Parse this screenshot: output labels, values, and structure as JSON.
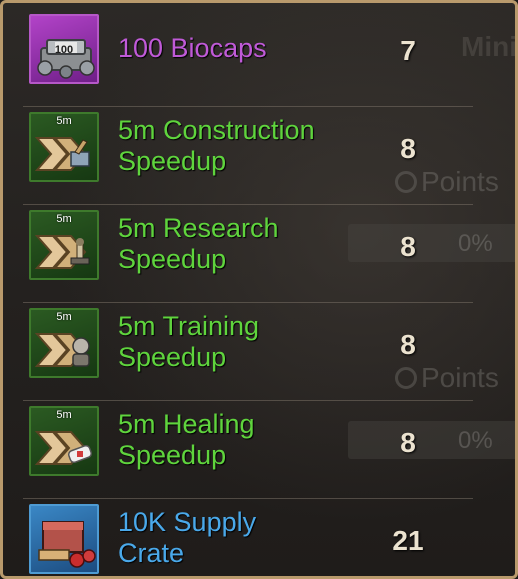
{
  "rewards": [
    {
      "name_line1": "100 Biocaps",
      "name_line2": "",
      "quantity": "7",
      "color": "#c05ad8",
      "icon": "biocaps-icon",
      "icon_tag": "100"
    },
    {
      "name_line1": "5m Construction",
      "name_line2": "Speedup",
      "quantity": "8",
      "color": "#5fd43d",
      "icon": "construction-speedup-icon",
      "icon_tag": "5m"
    },
    {
      "name_line1": "5m Research",
      "name_line2": "Speedup",
      "quantity": "8",
      "color": "#5fd43d",
      "icon": "research-speedup-icon",
      "icon_tag": "5m"
    },
    {
      "name_line1": "5m Training",
      "name_line2": "Speedup",
      "quantity": "8",
      "color": "#5fd43d",
      "icon": "training-speedup-icon",
      "icon_tag": "5m"
    },
    {
      "name_line1": "5m Healing",
      "name_line2": "Speedup",
      "quantity": "8",
      "color": "#5fd43d",
      "icon": "healing-speedup-icon",
      "icon_tag": "5m"
    },
    {
      "name_line1": "10K Supply",
      "name_line2": "Crate",
      "quantity": "21",
      "color": "#4aa9ea",
      "icon": "supply-crate-icon",
      "icon_tag": ""
    }
  ],
  "background": {
    "points_label": "Points",
    "percent_label": "0%",
    "header_right": "Mini"
  }
}
